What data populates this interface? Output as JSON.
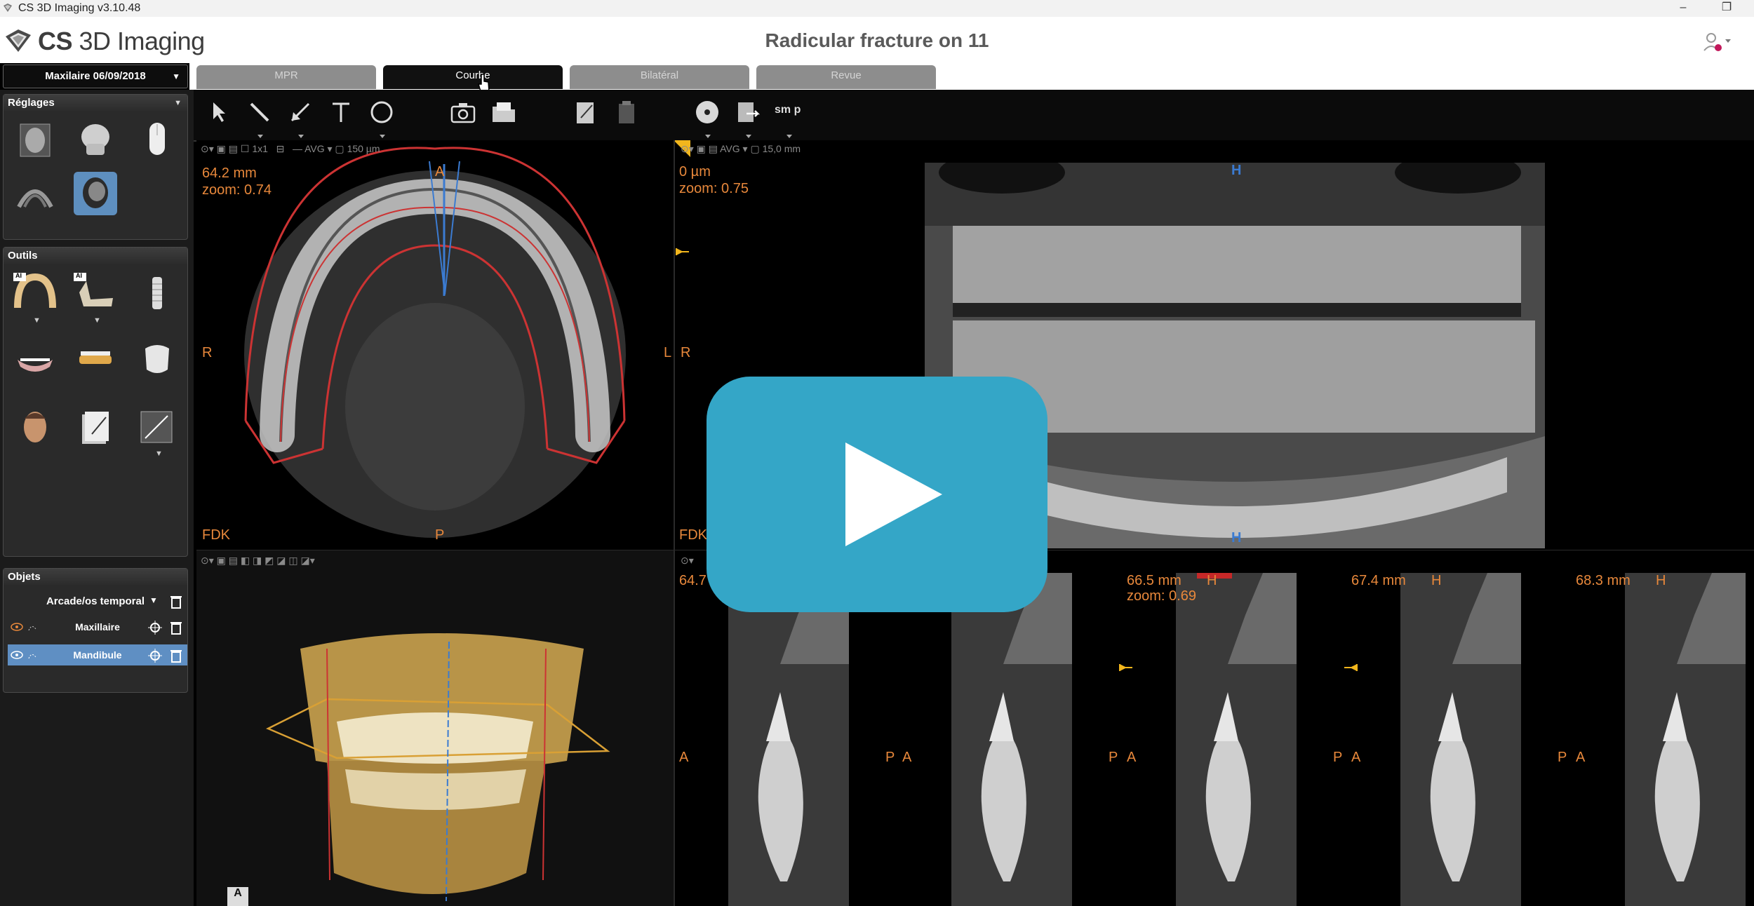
{
  "window": {
    "title": "CS 3D Imaging v3.10.48",
    "minimize": "–",
    "restore": "❐"
  },
  "app": {
    "logo_bold": "CS",
    "logo_rest": " 3D Imaging",
    "case_title": "Radicular fracture on 11"
  },
  "selector": {
    "value": "Maxilaire 06/09/2018"
  },
  "tabs": [
    {
      "label": "MPR",
      "active": false
    },
    {
      "label": "Courbe",
      "active": true
    },
    {
      "label": "Bilatéral",
      "active": false
    },
    {
      "label": "Revue",
      "active": false
    }
  ],
  "panels": {
    "reglages": {
      "title": "Réglages"
    },
    "outils": {
      "title": "Outils",
      "ai_badge": "AI"
    },
    "objets": {
      "title": "Objets",
      "dropdown": "Arcade/os temporal",
      "items": [
        {
          "label": "Maxillaire",
          "selected": false
        },
        {
          "label": "Mandibule",
          "selected": true
        }
      ]
    }
  },
  "toolbar": {
    "smop": "sm p"
  },
  "axial": {
    "toolbar_size": "1x1",
    "toolbar_avg": "AVG",
    "toolbar_res": "150 µm",
    "measure": "64.2 mm",
    "zoom": "zoom: 0.74",
    "label_a": "A",
    "label_p": "P",
    "label_r": "R",
    "label_l": "L",
    "algo": "FDK"
  },
  "pano": {
    "toolbar_avg": "AVG",
    "toolbar_thick": "15,0 mm",
    "measure": "0 µm",
    "zoom": "zoom: 0.75",
    "label_r": "R",
    "label_h": "H",
    "algo": "FDK"
  },
  "cross": {
    "slices": [
      {
        "measure": "64.7 mm",
        "zoom": ""
      },
      {
        "measure": "66.5 mm",
        "zoom": "zoom: 0.69"
      },
      {
        "measure": "67.4 mm",
        "zoom": ""
      },
      {
        "measure": "68.3 mm",
        "zoom": ""
      }
    ],
    "label_a": "A",
    "label_p": "P",
    "label_h": "H"
  },
  "volume": {
    "orientation": "A"
  },
  "colors": {
    "accent_orange": "#e8883b",
    "play_button": "#34a6c7",
    "selection_blue": "#5f8fc3"
  }
}
